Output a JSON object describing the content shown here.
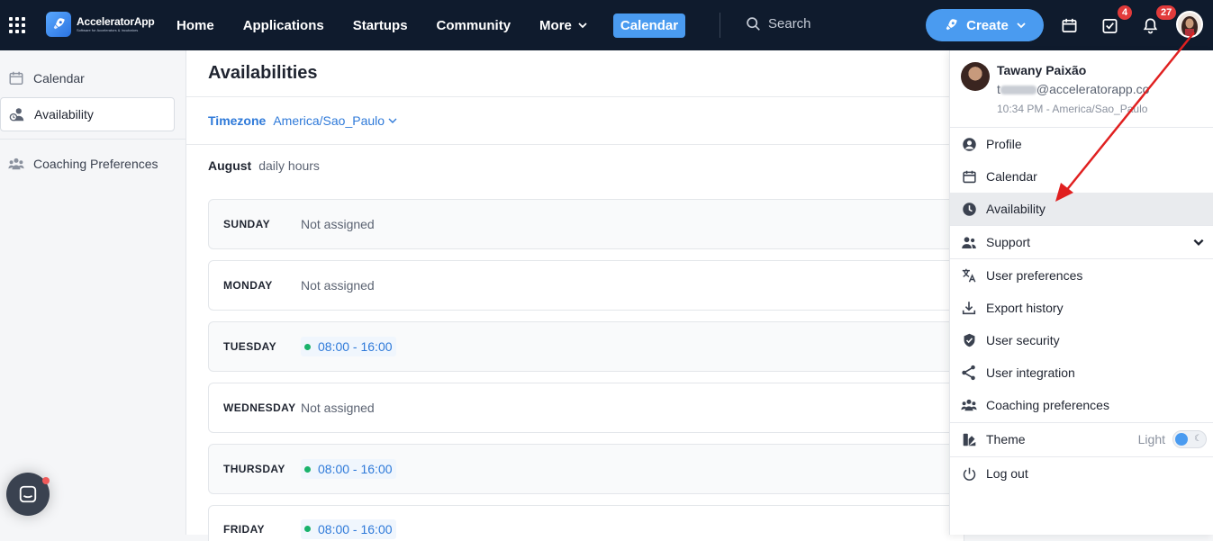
{
  "app": {
    "name": "AcceleratorApp",
    "tagline": "Software for Accelerators & Incubators"
  },
  "nav": {
    "items": [
      "Home",
      "Applications",
      "Startups",
      "Community",
      "More",
      "Calendar"
    ],
    "active": "Calendar",
    "search_placeholder": "Search",
    "create_label": "Create",
    "tasks_badge": "4",
    "notifications_badge": "27"
  },
  "sidebar": {
    "items": [
      {
        "label": "Calendar",
        "icon": "calendar-icon"
      },
      {
        "label": "Availability",
        "icon": "availability-icon",
        "active": true
      },
      {
        "label": "Coaching Preferences",
        "icon": "group-icon"
      }
    ]
  },
  "main": {
    "title": "Availabilities",
    "timezone_label": "Timezone",
    "timezone_value": "America/Sao_Paulo",
    "month": "August",
    "month_sub": "daily hours",
    "days": [
      {
        "name": "SUNDAY",
        "status": "Not assigned",
        "slot": null
      },
      {
        "name": "MONDAY",
        "status": "Not assigned",
        "slot": null
      },
      {
        "name": "TUESDAY",
        "status": "",
        "slot": "08:00 - 16:00"
      },
      {
        "name": "WEDNESDAY",
        "status": "Not assigned",
        "slot": null
      },
      {
        "name": "THURSDAY",
        "status": "",
        "slot": "08:00 - 16:00"
      },
      {
        "name": "FRIDAY",
        "status": "",
        "slot": "08:00 - 16:00"
      }
    ]
  },
  "menu": {
    "user_name": "Tawany Paixão",
    "email_prefix": "t",
    "email_domain": "@acceleratorapp.co",
    "local_time": "10:34 PM - America/Sao_Paulo",
    "items": [
      {
        "label": "Profile",
        "icon": "user-circle-icon"
      },
      {
        "label": "Calendar",
        "icon": "calendar-icon"
      },
      {
        "label": "Availability",
        "icon": "clock-icon",
        "highlighted": true
      },
      {
        "label": "Support",
        "icon": "users-icon"
      },
      {
        "label": "User preferences",
        "icon": "translate-icon"
      },
      {
        "label": "Export history",
        "icon": "download-icon"
      },
      {
        "label": "User security",
        "icon": "shield-icon"
      },
      {
        "label": "User integration",
        "icon": "integration-icon"
      },
      {
        "label": "Coaching preferences",
        "icon": "group-icon"
      },
      {
        "label": "Theme",
        "icon": "theme-icon"
      },
      {
        "label": "Log out",
        "icon": "power-icon"
      }
    ],
    "theme_value": "Light"
  },
  "colors": {
    "topbar": "#0f1b2d",
    "accent": "#4a9bf0",
    "link": "#2f7ad9",
    "badge": "#e23b3b",
    "slot_dot": "#19b26b",
    "annotation_arrow": "#e02020"
  }
}
